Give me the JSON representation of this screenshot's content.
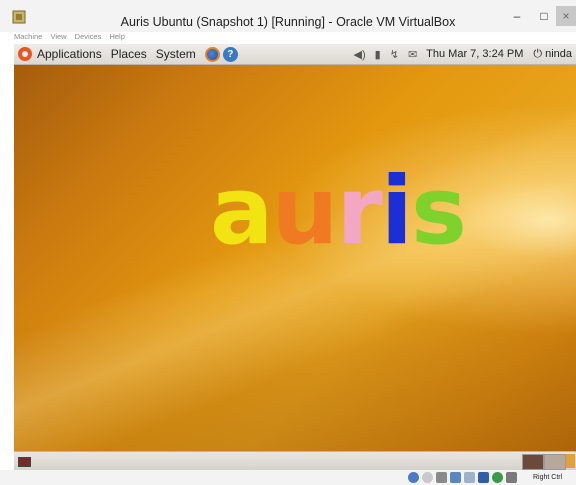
{
  "window": {
    "title": "Auris Ubuntu (Snapshot 1) [Running] - Oracle VM VirtualBox",
    "minimize_glyph": "–",
    "maximize_glyph": "□",
    "close_glyph": "×"
  },
  "vbox_menu": [
    "Machine",
    "View",
    "Devices",
    "Help"
  ],
  "panel": {
    "applications": "Applications",
    "places": "Places",
    "system": "System",
    "help_glyph": "?",
    "clock": "Thu Mar  7,  3:24 PM",
    "user": "ninda",
    "tray_icons": [
      "volume-icon",
      "battery-icon",
      "network-icon",
      "mail-icon"
    ]
  },
  "desktop": {
    "logo_letters": [
      {
        "char": "a",
        "color": "#f2e312"
      },
      {
        "char": "u",
        "color": "#f07a22"
      },
      {
        "char": "r",
        "color": "#f4a7c2"
      },
      {
        "char": "i",
        "color": "#1c2fd6"
      },
      {
        "char": "s",
        "color": "#7fd22c"
      }
    ]
  },
  "status_bar": {
    "host_key": "Right Ctrl"
  }
}
